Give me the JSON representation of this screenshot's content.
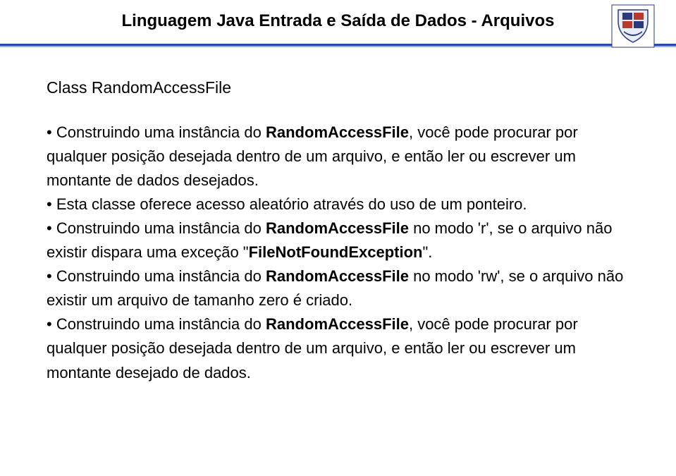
{
  "header": {
    "title": "Linguagem Java Entrada e Saída de Dados - Arquivos"
  },
  "content": {
    "section_title": "Class RandomAccessFile",
    "b1_a": "• Construindo uma instância do ",
    "b1_b": "RandomAccessFile",
    "b1_c": ", você pode procurar por qualquer posição desejada dentro de um arquivo, e então ler ou escrever um montante de dados desejados.",
    "b2": "• Esta classe oferece acesso aleatório através do uso de um ponteiro.",
    "b3_a": "• Construindo uma instância do ",
    "b3_b": "RandomAccessFile",
    "b3_c": " no modo 'r', se o arquivo não existir dispara uma exceção \"",
    "b3_d": "FileNotFoundException",
    "b3_e": "\".",
    "b4_a": "• Construindo uma instância do ",
    "b4_b": "RandomAccessFile",
    "b4_c": " no modo 'rw', se o arquivo não existir um arquivo de tamanho zero é criado.",
    "b5_a": "• Construindo uma instância do ",
    "b5_b": "RandomAccessFile",
    "b5_c": ", você pode procurar por qualquer posição desejada dentro de um arquivo, e então ler ou escrever um montante desejado de dados."
  }
}
